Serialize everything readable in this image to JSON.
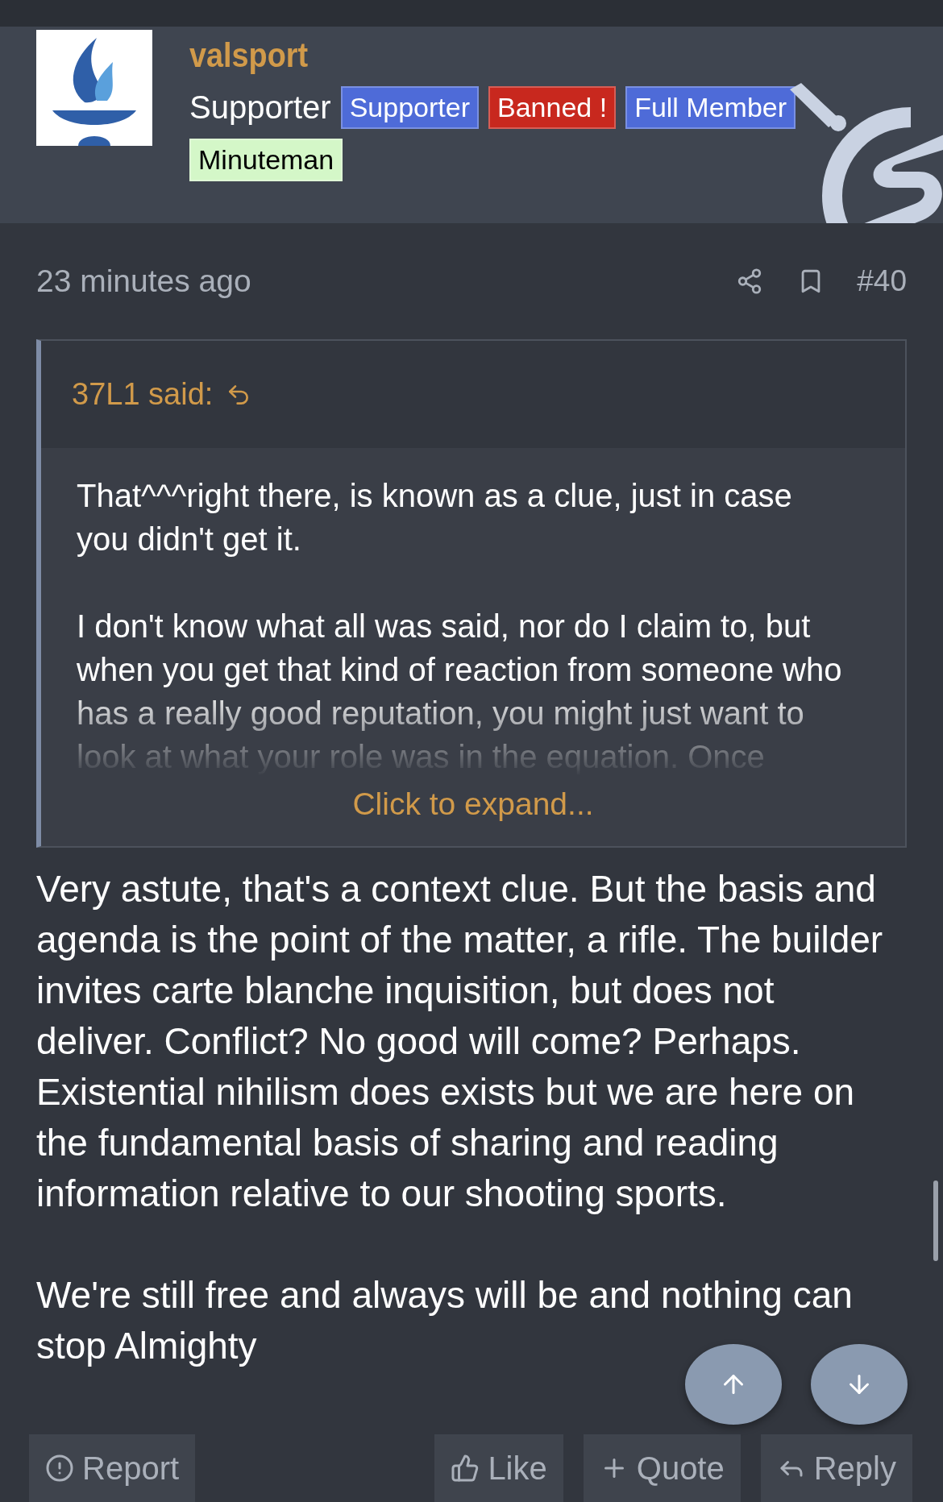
{
  "post": {
    "author": "valsport",
    "user_title": "Supporter",
    "badges": [
      {
        "label": "Supporter",
        "color": "#4e6bd8"
      },
      {
        "label": "Banned !",
        "color": "#c8281e"
      },
      {
        "label": "Full Member",
        "color": "#4e6bd8"
      },
      {
        "label": "Minuteman",
        "color": "#d4f7c8"
      }
    ],
    "time": "23 minutes ago",
    "number": "#40",
    "quote": {
      "author": "37L1 said:",
      "paragraphs": [
        "That^^^right there, is known as a clue, just in case\nyou didn't get it.",
        "I don't know what all was said, nor do I claim to, but\nwhen you get that kind of reaction from someone who\nhas a really good reputation, you might just want to\nlook at what your role was in the equation. Once"
      ],
      "expand": "Click to expand..."
    },
    "paragraphs": [
      "Very astute, that's a context clue. But the basis and agenda is the point of the matter, a rifle. The builder invites carte blanche inquisition, but does not deliver. Conflict? No good will come? Perhaps. Existential nihilism does exists but we are here on the fundamental basis of sharing and reading information relative to our shooting sports.",
      "We're still free and always will be and nothing can stop Almighty"
    ],
    "actions": [
      {
        "kind": "report",
        "label": "Report"
      },
      {
        "kind": "like",
        "label": "Like"
      },
      {
        "kind": "quote",
        "label": "Quote"
      },
      {
        "kind": "reply",
        "label": "Reply"
      }
    ]
  }
}
